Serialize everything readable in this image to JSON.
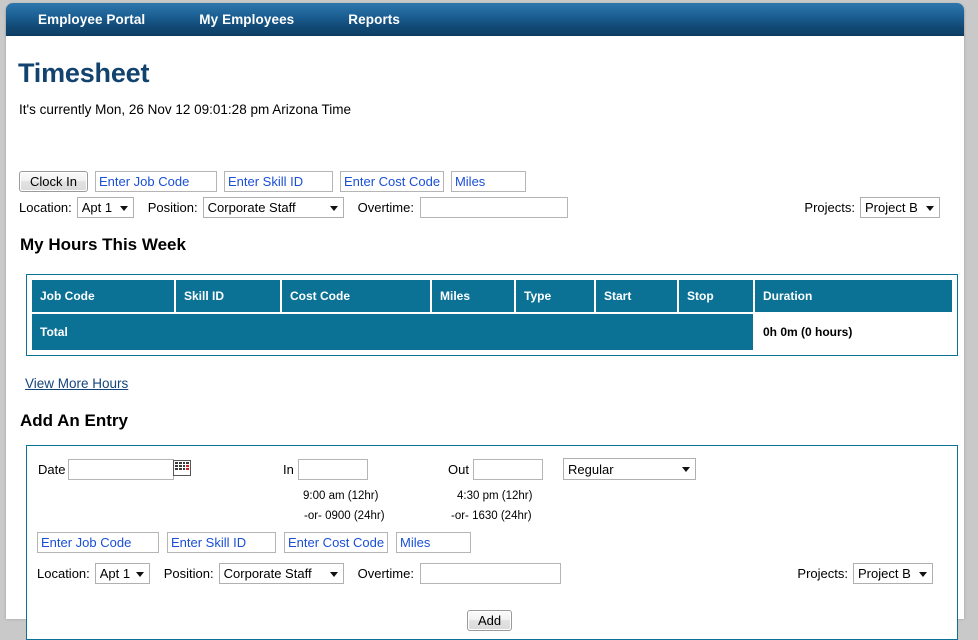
{
  "nav": {
    "items": [
      {
        "label": "Employee Portal"
      },
      {
        "label": "My Employees"
      },
      {
        "label": "Reports"
      }
    ]
  },
  "page": {
    "title": "Timesheet",
    "clock_status": "It's currently Mon, 26 Nov 12 09:01:28 pm Arizona Time"
  },
  "clock_bar": {
    "clock_in_label": "Clock In",
    "job_code_placeholder": "Enter Job Code",
    "job_code_value": "",
    "skill_id_placeholder": "Enter Skill ID",
    "skill_id_value": "",
    "cost_code_placeholder": "Enter Cost Code",
    "cost_code_value": "",
    "miles_placeholder": "Miles",
    "miles_value": "",
    "location_label": "Location:",
    "location_value": "Apt 1",
    "position_label": "Position:",
    "position_value": "Corporate Staff",
    "overtime_label": "Overtime:",
    "overtime_value": "",
    "projects_label": "Projects:",
    "projects_value": "Project B"
  },
  "hours_section": {
    "heading": "My Hours This Week",
    "columns": [
      "Job Code",
      "Skill ID",
      "Cost Code",
      "Miles",
      "Type",
      "Start",
      "Stop",
      "Duration"
    ],
    "rows": [],
    "total_label": "Total",
    "total_duration": "0h 0m (0 hours)",
    "view_more_label": "View More Hours"
  },
  "add_entry": {
    "heading": "Add An Entry",
    "date_label": "Date",
    "date_value": "",
    "calendar_icon": "calendar-icon",
    "in_label": "In",
    "in_value": "",
    "in_hint_12hr": "9:00 am (12hr)",
    "in_hint_24hr": "-or- 0900 (24hr)",
    "out_label": "Out",
    "out_value": "",
    "out_hint_12hr": "4:30 pm (12hr)",
    "out_hint_24hr": "-or- 1630 (24hr)",
    "type_value": "Regular",
    "job_code_placeholder": "Enter Job Code",
    "job_code_value": "",
    "skill_id_placeholder": "Enter Skill ID",
    "skill_id_value": "",
    "cost_code_placeholder": "Enter Cost Code",
    "cost_code_value": "",
    "miles_placeholder": "Miles",
    "miles_value": "",
    "location_label": "Location:",
    "location_value": "Apt 1",
    "position_label": "Position:",
    "position_value": "Corporate Staff",
    "overtime_label": "Overtime:",
    "overtime_value": "",
    "projects_label": "Projects:",
    "projects_value": "Project B",
    "add_button_label": "Add"
  },
  "colors": {
    "nav_blue": "#1b5f93",
    "title_blue": "#12426e",
    "table_teal": "#0b7296",
    "link_blue": "#14457a",
    "placeholder_blue": "#1a4fd6"
  }
}
